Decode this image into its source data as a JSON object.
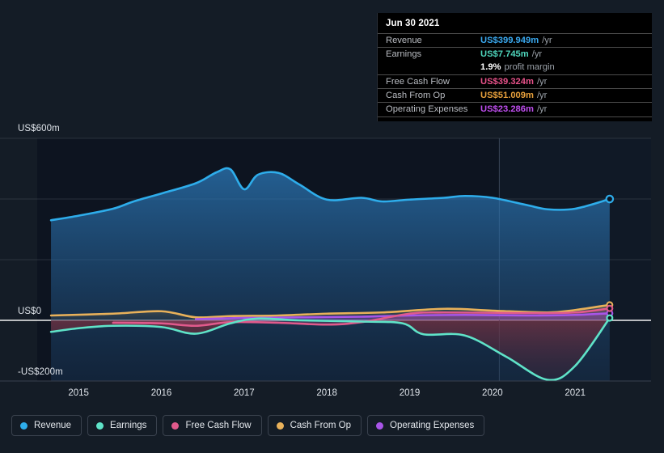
{
  "chart_data": {
    "type": "area",
    "title": "",
    "xlabel": "",
    "ylabel": "",
    "ylim": [
      -200,
      600
    ],
    "yunit": "US$m",
    "grid": true,
    "legend_position": "bottom",
    "y_ticks": [
      {
        "label": "US$600m",
        "value": 600
      },
      {
        "label": "US$0",
        "value": 0
      },
      {
        "label": "-US$200m",
        "value": -200
      }
    ],
    "x_ticks": [
      "2015",
      "2016",
      "2017",
      "2018",
      "2019",
      "2020",
      "2021"
    ],
    "x_domain": [
      "2014-07",
      "2021-12"
    ],
    "forecast_divider_x": "2020-02",
    "series": [
      {
        "name": "Revenue",
        "color": "#2eadeb",
        "x": [
          "2014-09",
          "2015-01",
          "2015-06",
          "2015-09",
          "2016-01",
          "2016-06",
          "2016-09",
          "2016-11",
          "2017-01",
          "2017-03",
          "2017-06",
          "2017-09",
          "2018-01",
          "2018-06",
          "2018-09",
          "2019-01",
          "2019-06",
          "2019-09",
          "2020-01",
          "2020-06",
          "2020-09",
          "2021-01",
          "2021-06"
        ],
        "values": [
          330,
          345,
          368,
          392,
          418,
          452,
          488,
          498,
          432,
          480,
          486,
          448,
          398,
          404,
          392,
          398,
          404,
          410,
          404,
          380,
          366,
          368,
          399.949
        ]
      },
      {
        "name": "Earnings",
        "color": "#5fe3c8",
        "x": [
          "2014-09",
          "2015-01",
          "2015-06",
          "2016-01",
          "2016-06",
          "2016-11",
          "2017-03",
          "2017-09",
          "2018-06",
          "2018-12",
          "2019-03",
          "2019-09",
          "2020-03",
          "2020-09",
          "2021-01",
          "2021-06"
        ],
        "values": [
          -38,
          -26,
          -18,
          -22,
          -44,
          -10,
          6,
          0,
          -4,
          -10,
          -46,
          -50,
          -120,
          -196,
          -150,
          7.745
        ]
      },
      {
        "name": "Free Cash Flow",
        "color": "#e05a8c",
        "x": [
          "2015-06",
          "2016-01",
          "2016-06",
          "2016-11",
          "2017-06",
          "2018-01",
          "2018-06",
          "2019-01",
          "2019-06",
          "2020-06",
          "2021-01",
          "2021-06"
        ],
        "values": [
          -8,
          -10,
          -18,
          -6,
          -8,
          -14,
          -6,
          22,
          26,
          24,
          26,
          39.324
        ]
      },
      {
        "name": "Cash From Op",
        "color": "#e8b15a",
        "x": [
          "2014-09",
          "2015-06",
          "2016-01",
          "2016-06",
          "2016-11",
          "2017-06",
          "2018-01",
          "2018-09",
          "2019-06",
          "2020-01",
          "2020-09",
          "2021-01",
          "2021-06"
        ],
        "values": [
          16,
          22,
          30,
          10,
          14,
          16,
          22,
          26,
          38,
          32,
          26,
          34,
          51.009
        ]
      },
      {
        "name": "Operating Expenses",
        "color": "#a855e8",
        "x": [
          "2016-06",
          "2017-01",
          "2017-09",
          "2018-06",
          "2019-01",
          "2019-09",
          "2020-06",
          "2021-01",
          "2021-06"
        ],
        "values": [
          4,
          8,
          10,
          12,
          16,
          18,
          16,
          18,
          23.286
        ]
      }
    ]
  },
  "tooltip": {
    "date": "Jun 30 2021",
    "unit_suffix": "/yr",
    "rows": [
      {
        "label": "Revenue",
        "value": "US$399.949m",
        "color": "#3aa9f0",
        "unit": "/yr"
      },
      {
        "label": "Earnings",
        "value": "US$7.745m",
        "color": "#4fd6bd",
        "unit": "/yr"
      },
      {
        "label": "",
        "value": "1.9%",
        "color": "#ffffff",
        "unit": "profit margin"
      },
      {
        "label": "Free Cash Flow",
        "value": "US$39.324m",
        "color": "#e8528a",
        "unit": "/yr"
      },
      {
        "label": "Cash From Op",
        "value": "US$51.009m",
        "color": "#e9a13c",
        "unit": "/yr"
      },
      {
        "label": "Operating Expenses",
        "value": "US$23.286m",
        "color": "#c04ef0",
        "unit": "/yr"
      }
    ]
  },
  "legend": {
    "items": [
      {
        "label": "Revenue",
        "color": "#2eadeb"
      },
      {
        "label": "Earnings",
        "color": "#5fe3c8"
      },
      {
        "label": "Free Cash Flow",
        "color": "#e05a8c"
      },
      {
        "label": "Cash From Op",
        "color": "#e8b15a"
      },
      {
        "label": "Operating Expenses",
        "color": "#a855e8"
      }
    ]
  },
  "axes": {
    "y": [
      {
        "label": "US$600m"
      },
      {
        "label": "US$0"
      },
      {
        "label": "-US$200m"
      }
    ],
    "x": [
      {
        "label": "2015"
      },
      {
        "label": "2016"
      },
      {
        "label": "2017"
      },
      {
        "label": "2018"
      },
      {
        "label": "2019"
      },
      {
        "label": "2020"
      },
      {
        "label": "2021"
      }
    ]
  }
}
